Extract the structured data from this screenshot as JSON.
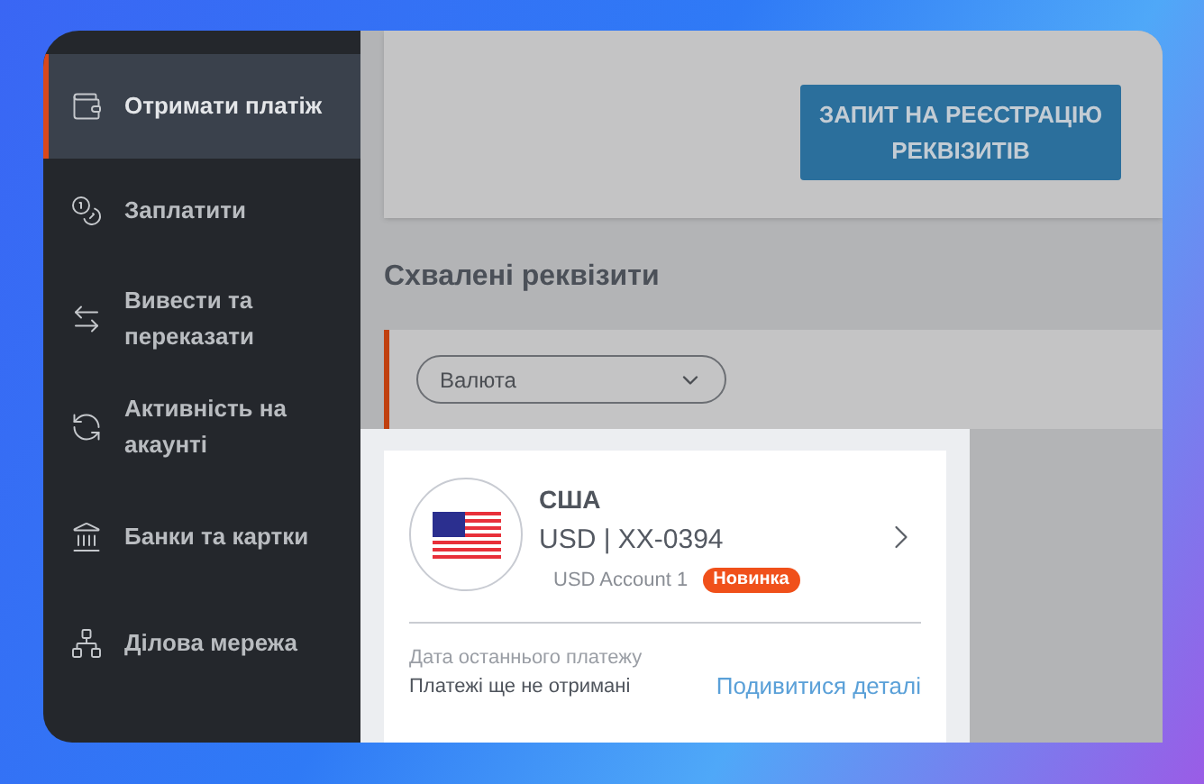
{
  "sidebar": {
    "items": [
      {
        "label": "Отримати платіж",
        "selected": true
      },
      {
        "label": "Заплатити",
        "selected": false
      },
      {
        "label": "Вивести та переказати",
        "selected": false
      },
      {
        "label": "Активність на акаунті",
        "selected": false
      },
      {
        "label": "Банки та картки",
        "selected": false
      },
      {
        "label": "Ділова мережа",
        "selected": false
      }
    ]
  },
  "register_button": "ЗАПИТ НА РЕЄСТРАЦІЮ РЕКВІЗИТІВ",
  "section_title": "Схвалені реквізити",
  "filter": {
    "placeholder": "Валюта"
  },
  "account_card": {
    "country": "США",
    "account": "USD | XX-0394",
    "name": "USD Account 1",
    "badge": "Новинка",
    "last_payment_label": "Дата останнього платежу",
    "last_payment_value": "Платежі ще не отримані",
    "details_link": "Подивитися деталі"
  }
}
